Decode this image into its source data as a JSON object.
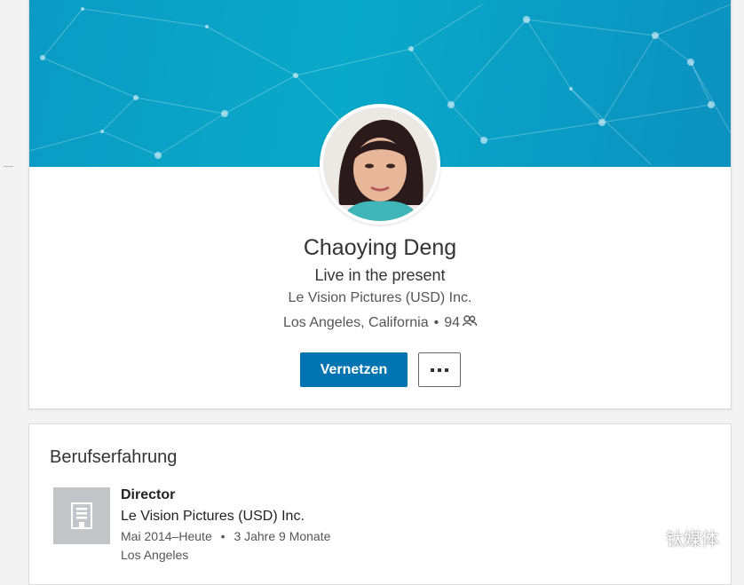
{
  "profile": {
    "name": "Chaoying Deng",
    "headline": "Live in the present",
    "company": "Le Vision Pictures (USD) Inc.",
    "location": "Los Angeles, California",
    "separator": "•",
    "connections": "94",
    "connect_label": "Vernetzen"
  },
  "experience": {
    "section_title": "Berufserfahrung",
    "items": [
      {
        "title": "Director",
        "company": "Le Vision Pictures (USD) Inc.",
        "dates": "Mai 2014–Heute",
        "duration": "3 Jahre 9 Monate",
        "location": "Los Angeles"
      }
    ]
  },
  "watermark": {
    "text": "钛媒体"
  },
  "colors": {
    "primary_button": "#0073b1",
    "banner": "#0a9bc4"
  }
}
